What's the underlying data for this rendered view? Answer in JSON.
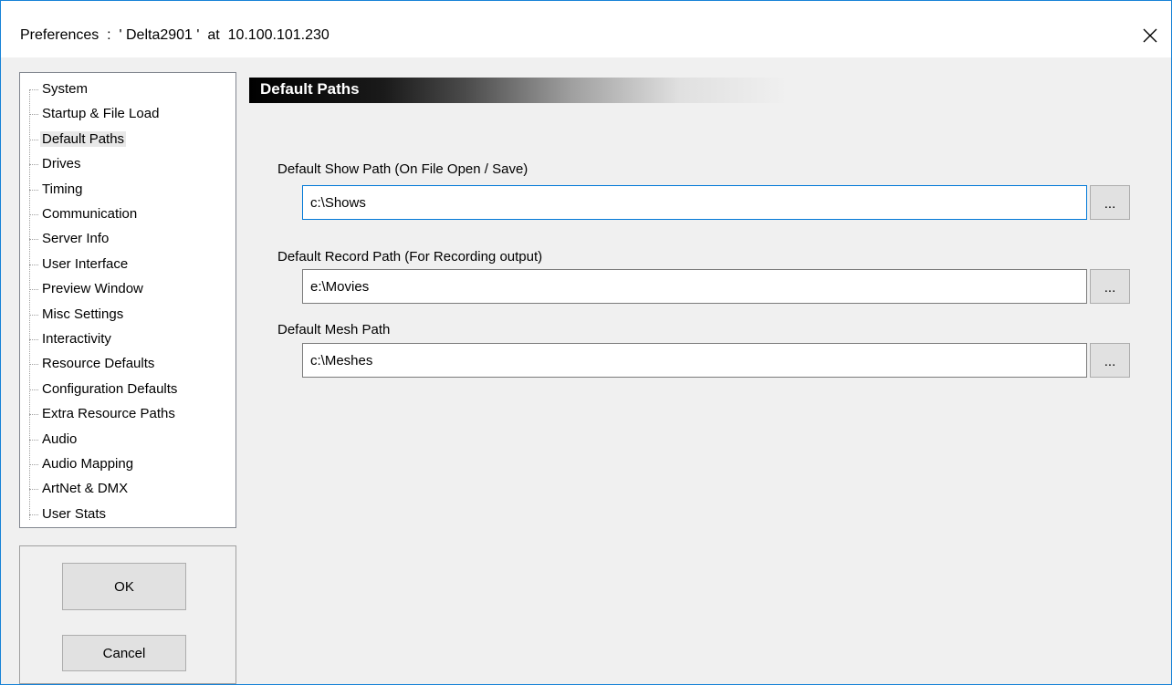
{
  "window": {
    "title": "Preferences  :  ' Delta2901 '  at  10.100.101.230",
    "close_glyph": "✕"
  },
  "tree": {
    "selected": "Default Paths",
    "items": [
      {
        "label": "System"
      },
      {
        "label": "Startup & File Load"
      },
      {
        "label": "Default Paths"
      },
      {
        "label": "Drives"
      },
      {
        "label": "Timing"
      },
      {
        "label": "Communication"
      },
      {
        "label": "Server Info"
      },
      {
        "label": "User Interface"
      },
      {
        "label": "Preview Window"
      },
      {
        "label": "Misc Settings"
      },
      {
        "label": "Interactivity"
      },
      {
        "label": "Resource Defaults"
      },
      {
        "label": "Configuration Defaults"
      },
      {
        "label": "Extra Resource Paths"
      },
      {
        "label": "Audio"
      },
      {
        "label": "Audio Mapping"
      },
      {
        "label": "ArtNet & DMX"
      },
      {
        "label": "User Stats"
      }
    ]
  },
  "buttons": {
    "ok": "OK",
    "cancel": "Cancel"
  },
  "content": {
    "header": "Default Paths",
    "fields": [
      {
        "label": "Default Show Path (On File Open / Save)",
        "value": "c:\\Shows",
        "browse": "..."
      },
      {
        "label": "Default Record Path (For Recording output)",
        "value": "e:\\Movies",
        "browse": "..."
      },
      {
        "label": "Default Mesh Path",
        "value": "c:\\Meshes",
        "browse": "..."
      }
    ]
  },
  "icons": {
    "close": "close-icon"
  }
}
